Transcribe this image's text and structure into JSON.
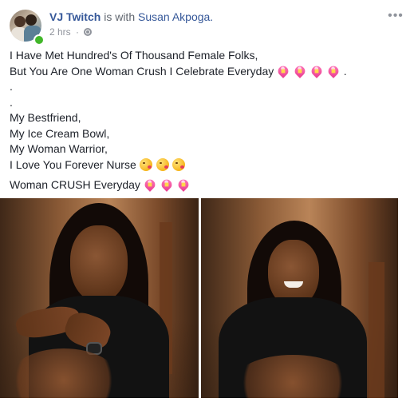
{
  "post": {
    "author": "VJ Twitch",
    "with_text": "is with",
    "tagged": "Susan Akpoga.",
    "time": "2 hrs",
    "dot": "·",
    "more": "•••",
    "icons": {
      "privacy": "globe-icon",
      "menu": "more-options-icon",
      "presence": "online-dot"
    },
    "lines": {
      "l1": "I Have Met Hundred's Of Thousand Female Folks,",
      "l2": "But You Are One Woman Crush I Celebrate Everyday",
      "l2_end": ".",
      "l3": ".",
      "l4": ".",
      "l5": "My Bestfriend,",
      "l6": "My Ice Cream Bowl,",
      "l7": "My Woman Warrior,",
      "l8": "I Love You Forever Nurse",
      "l9": "Woman CRUSH Everyday"
    },
    "emoji": {
      "heart": "sparkling-heart-icon",
      "kiss": "face-blowing-kiss-icon"
    },
    "photos": [
      "photo-left",
      "photo-right"
    ]
  }
}
